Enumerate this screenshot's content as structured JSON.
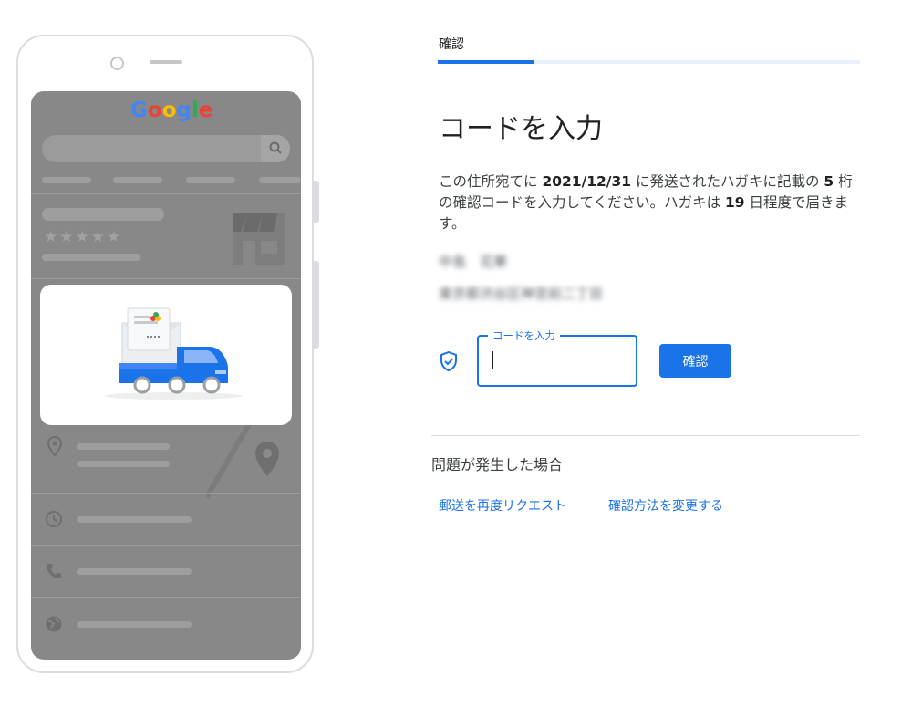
{
  "phone": {
    "google_logo": [
      "G",
      "o",
      "o",
      "g",
      "l",
      "e"
    ],
    "google_colors": [
      "#4285f4",
      "#ea4335",
      "#fbbc05",
      "#4285f4",
      "#34a853",
      "#ea4335"
    ],
    "stars": "★★★★★",
    "icons": [
      "search-icon",
      "storefront-icon",
      "location-pin-icon",
      "map-pin-icon",
      "clock-icon",
      "phone-icon",
      "globe-icon"
    ]
  },
  "panel": {
    "step_label": "確認",
    "progress_percent": 23,
    "title": "コードを入力",
    "desc_1": "この住所宛てに ",
    "desc_date": "2021/12/31",
    "desc_2": " に発送されたハガキに記載の ",
    "desc_digits": "5",
    "desc_3": " 桁の確認コードを入力してください。ハガキは ",
    "desc_days": "19",
    "desc_4": " 日程度で届きます。",
    "address_line1": "中島　花華",
    "address_line2": "東京都渋谷区神宮前二丁目",
    "code_field_label": "コードを入力",
    "code_value": "",
    "confirm_label": "確認",
    "trouble_heading": "問題が発生した場合",
    "resend_link": "郵送を再度リクエスト",
    "change_method_link": "確認方法を変更する",
    "accent_color": "#1a73e8"
  }
}
